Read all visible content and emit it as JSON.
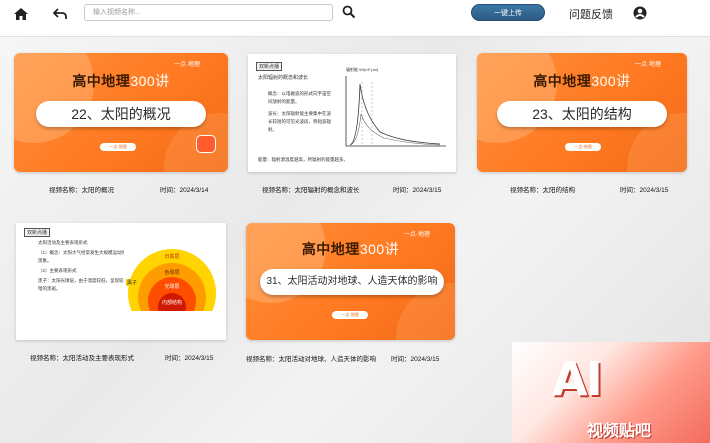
{
  "topbar": {
    "search_placeholder": "输入视频名称...",
    "upload_label": "一键上传",
    "feedback_label": "问题反馈"
  },
  "videos": [
    {
      "thumb_brand": "一点·地理",
      "thumb_series": "高中地理",
      "thumb_count": "300讲",
      "thumb_title": "22、太阳的概况",
      "thumb_button": "一点·地理",
      "name": "视频名称：太阳的概况",
      "time": "时间：2024/3/14"
    },
    {
      "thumb_tag": "双新点播",
      "thumb_heading": "太阳辐射的概念和波长",
      "thumb_note1": "概念：以电磁波的形式向宇宙空间放射的能量。",
      "thumb_note2": "波长：太阳辐射能主要集中在波长较短的可见光波段，称短波辐射。",
      "thumb_note3": "能量：辐射源温度越高，所辐射的能量越多。",
      "chart_axis": "辐射能 W/(m²·μm)",
      "name": "视频名称：太阳辐射的概念和波长",
      "time": "时间：2024/3/15"
    },
    {
      "thumb_brand": "一点·地理",
      "thumb_series": "高中地理",
      "thumb_count": "300讲",
      "thumb_title": "23、太阳的结构",
      "thumb_button": "一点·地理",
      "name": "视频名称：太阳的结构",
      "time": "时间：2024/3/15"
    },
    {
      "thumb_tag": "双新点播",
      "thumb_heading": "太阳活动及主要表现形式",
      "thumb_note1": "（1）概念：太阳大气经常发生大规模运动的现象。",
      "thumb_note2": "（2）主要表现形式",
      "thumb_note3": "黑子：太阳光球层，由于温度较低，呈现较暗的黑斑。",
      "layer_labels": [
        "日冕层",
        "色球层",
        "光球层",
        "内部结构"
      ],
      "layer_side": "黑子",
      "name": "视频名称：太阳活动及主要表现形式",
      "time": "时间：2024/3/15"
    },
    {
      "thumb_brand": "一点·地理",
      "thumb_series": "高中地理",
      "thumb_count": "300讲",
      "thumb_title": "31、太阳活动对地球、人造天体的影响",
      "thumb_button": "一点·地理",
      "name": "视频名称：太阳活动对地球、人造天体的影响",
      "time": "时间：2024/3/15"
    }
  ],
  "watermark": {
    "logo_text": "AI",
    "site_text": "视频贴吧"
  },
  "colors": {
    "accent_orange": "#ff7a22",
    "upload_blue": "#2f6190"
  }
}
